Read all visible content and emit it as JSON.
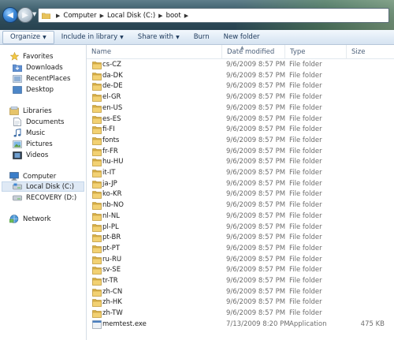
{
  "address": {
    "breadcrumbs": [
      "Computer",
      "Local Disk (C:)",
      "boot"
    ]
  },
  "toolbar": {
    "organize": "Organize",
    "include_in_library": "Include in library",
    "share_with": "Share with",
    "burn": "Burn",
    "new_folder": "New folder"
  },
  "nav": {
    "favorites": "Favorites",
    "downloads": "Downloads",
    "recent_places": "RecentPlaces",
    "desktop": "Desktop",
    "libraries": "Libraries",
    "documents": "Documents",
    "music": "Music",
    "pictures": "Pictures",
    "videos": "Videos",
    "computer": "Computer",
    "local_disk": "Local Disk (C:)",
    "recovery": "RECOVERY (D:)",
    "network": "Network"
  },
  "columns": {
    "name": "Name",
    "date_modified": "Date modified",
    "type": "Type",
    "size": "Size"
  },
  "files": [
    {
      "name": "cs-CZ",
      "date": "9/6/2009 8:57 PM",
      "type": "File folder",
      "size": "",
      "icon": "folder-icon"
    },
    {
      "name": "da-DK",
      "date": "9/6/2009 8:57 PM",
      "type": "File folder",
      "size": "",
      "icon": "folder-icon"
    },
    {
      "name": "de-DE",
      "date": "9/6/2009 8:57 PM",
      "type": "File folder",
      "size": "",
      "icon": "folder-icon"
    },
    {
      "name": "el-GR",
      "date": "9/6/2009 8:57 PM",
      "type": "File folder",
      "size": "",
      "icon": "folder-icon"
    },
    {
      "name": "en-US",
      "date": "9/6/2009 8:57 PM",
      "type": "File folder",
      "size": "",
      "icon": "folder-icon"
    },
    {
      "name": "es-ES",
      "date": "9/6/2009 8:57 PM",
      "type": "File folder",
      "size": "",
      "icon": "folder-icon"
    },
    {
      "name": "fi-FI",
      "date": "9/6/2009 8:57 PM",
      "type": "File folder",
      "size": "",
      "icon": "folder-icon"
    },
    {
      "name": "fonts",
      "date": "9/6/2009 8:57 PM",
      "type": "File folder",
      "size": "",
      "icon": "folder-icon"
    },
    {
      "name": "fr-FR",
      "date": "9/6/2009 8:57 PM",
      "type": "File folder",
      "size": "",
      "icon": "folder-icon"
    },
    {
      "name": "hu-HU",
      "date": "9/6/2009 8:57 PM",
      "type": "File folder",
      "size": "",
      "icon": "folder-icon"
    },
    {
      "name": "it-IT",
      "date": "9/6/2009 8:57 PM",
      "type": "File folder",
      "size": "",
      "icon": "folder-icon"
    },
    {
      "name": "ja-JP",
      "date": "9/6/2009 8:57 PM",
      "type": "File folder",
      "size": "",
      "icon": "folder-icon"
    },
    {
      "name": "ko-KR",
      "date": "9/6/2009 8:57 PM",
      "type": "File folder",
      "size": "",
      "icon": "folder-icon"
    },
    {
      "name": "nb-NO",
      "date": "9/6/2009 8:57 PM",
      "type": "File folder",
      "size": "",
      "icon": "folder-icon"
    },
    {
      "name": "nl-NL",
      "date": "9/6/2009 8:57 PM",
      "type": "File folder",
      "size": "",
      "icon": "folder-icon"
    },
    {
      "name": "pl-PL",
      "date": "9/6/2009 8:57 PM",
      "type": "File folder",
      "size": "",
      "icon": "folder-icon"
    },
    {
      "name": "pt-BR",
      "date": "9/6/2009 8:57 PM",
      "type": "File folder",
      "size": "",
      "icon": "folder-icon"
    },
    {
      "name": "pt-PT",
      "date": "9/6/2009 8:57 PM",
      "type": "File folder",
      "size": "",
      "icon": "folder-icon"
    },
    {
      "name": "ru-RU",
      "date": "9/6/2009 8:57 PM",
      "type": "File folder",
      "size": "",
      "icon": "folder-icon"
    },
    {
      "name": "sv-SE",
      "date": "9/6/2009 8:57 PM",
      "type": "File folder",
      "size": "",
      "icon": "folder-icon"
    },
    {
      "name": "tr-TR",
      "date": "9/6/2009 8:57 PM",
      "type": "File folder",
      "size": "",
      "icon": "folder-icon"
    },
    {
      "name": "zh-CN",
      "date": "9/6/2009 8:57 PM",
      "type": "File folder",
      "size": "",
      "icon": "folder-icon"
    },
    {
      "name": "zh-HK",
      "date": "9/6/2009 8:57 PM",
      "type": "File folder",
      "size": "",
      "icon": "folder-icon"
    },
    {
      "name": "zh-TW",
      "date": "9/6/2009 8:57 PM",
      "type": "File folder",
      "size": "",
      "icon": "folder-icon"
    },
    {
      "name": "memtest.exe",
      "date": "7/13/2009 8:20 PM",
      "type": "Application",
      "size": "475 KB",
      "icon": "application-icon"
    }
  ],
  "colors": {
    "folder": "#e8c35a",
    "selection": "#dfe9f5",
    "command_text": "#1e395b"
  }
}
